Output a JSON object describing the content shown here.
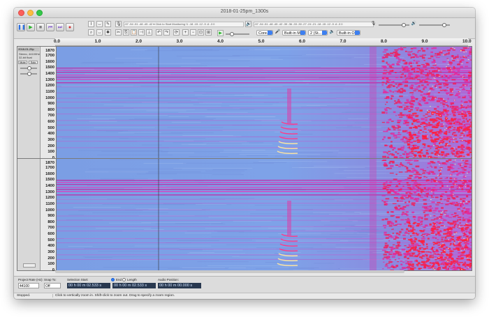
{
  "window": {
    "title": "2018-01-25pm_1300s"
  },
  "transport": {
    "buttons": [
      {
        "name": "pause-button",
        "glyph": "❚❚",
        "color": "#2a6fe0"
      },
      {
        "name": "play-button",
        "glyph": "▶",
        "color": "#2cb32c"
      },
      {
        "name": "stop-button",
        "glyph": "■",
        "color": "#7a7a7a"
      },
      {
        "name": "skip-start-button",
        "glyph": "⏮",
        "color": "#7a4cc7"
      },
      {
        "name": "skip-end-button",
        "glyph": "⏭",
        "color": "#7a4cc7"
      },
      {
        "name": "record-button",
        "glyph": "●",
        "color": "#d42c2c"
      }
    ]
  },
  "tools": {
    "row1": [
      "I",
      "↔",
      "✎"
    ],
    "row2": [
      "⌕",
      "↔",
      "✱"
    ]
  },
  "meters": {
    "recording": "-57 -54 -51 -48 -45 -42 ▾ Click to Start Monitoring !1 -18 -15 -12 -9 -6 -3 0",
    "playback": "-57 -54 -51 -48 -45 -42 -39 -36 -33 -30 -27 -24 -21 -18 -15 -12 -9 -6 -3 0"
  },
  "devices": {
    "host": "Core...",
    "mic": "Built-in Mi...",
    "channels": "2 (St...",
    "output": "Built-in Ou..."
  },
  "ruler": {
    "ticks": [
      "0.0",
      "1.0",
      "2.0",
      "3.0",
      "4.0",
      "5.0",
      "6.0",
      "7.0",
      "8.0",
      "9.0",
      "10.0"
    ]
  },
  "track": {
    "name": "2018-01-25p",
    "info1": "Stereo, 44100Hz",
    "info2": "32-bit float",
    "mute": "Mute",
    "solo": "Solo",
    "scale": [
      "1870",
      "1700",
      "1600",
      "1500",
      "1400",
      "1300",
      "1200",
      "1100",
      "1000",
      "900",
      "800",
      "700",
      "600",
      "500",
      "400",
      "300",
      "200",
      "100",
      "0"
    ]
  },
  "selection_toolbar": {
    "project_rate_label": "Project Rate (Hz):",
    "project_rate": "44100",
    "snap_label": "Snap To:",
    "snap": "Off",
    "selection_start_label": "Selection Start:",
    "end_label": "End",
    "length_label": "Length",
    "start_time": "00 h 00 m 02.533 s",
    "end_time": "00 h 00 m 02.533 s",
    "audio_position_label": "Audio Position:",
    "audio_position": "00 h 00 m 00.000 s"
  },
  "status": {
    "state": "Stopped.",
    "hint": "Click to vertically zoom in. Shift-click to zoom out. Drag to specify a zoom region."
  }
}
